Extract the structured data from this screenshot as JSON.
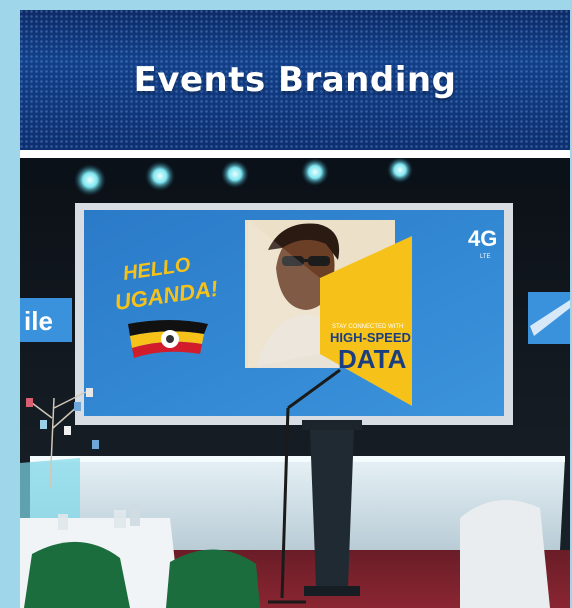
{
  "banner": {
    "title": "Events Branding"
  },
  "screen": {
    "greeting_line1": "HELLO",
    "greeting_line2": "UGANDA!",
    "network_badge": "4G",
    "network_sub": "LTE",
    "tagline_small": "STAY CONNECTED WITH",
    "tagline_medium": "HIGH-SPEED",
    "tagline_large": "DATA",
    "side_screen_text": "ile"
  },
  "colors": {
    "page_background": "#9fd6ea",
    "banner_blue": "#12408a",
    "screen_blue": "#2f7fd0",
    "accent_yellow": "#f6c21a",
    "flag_red": "#d21c2c"
  }
}
